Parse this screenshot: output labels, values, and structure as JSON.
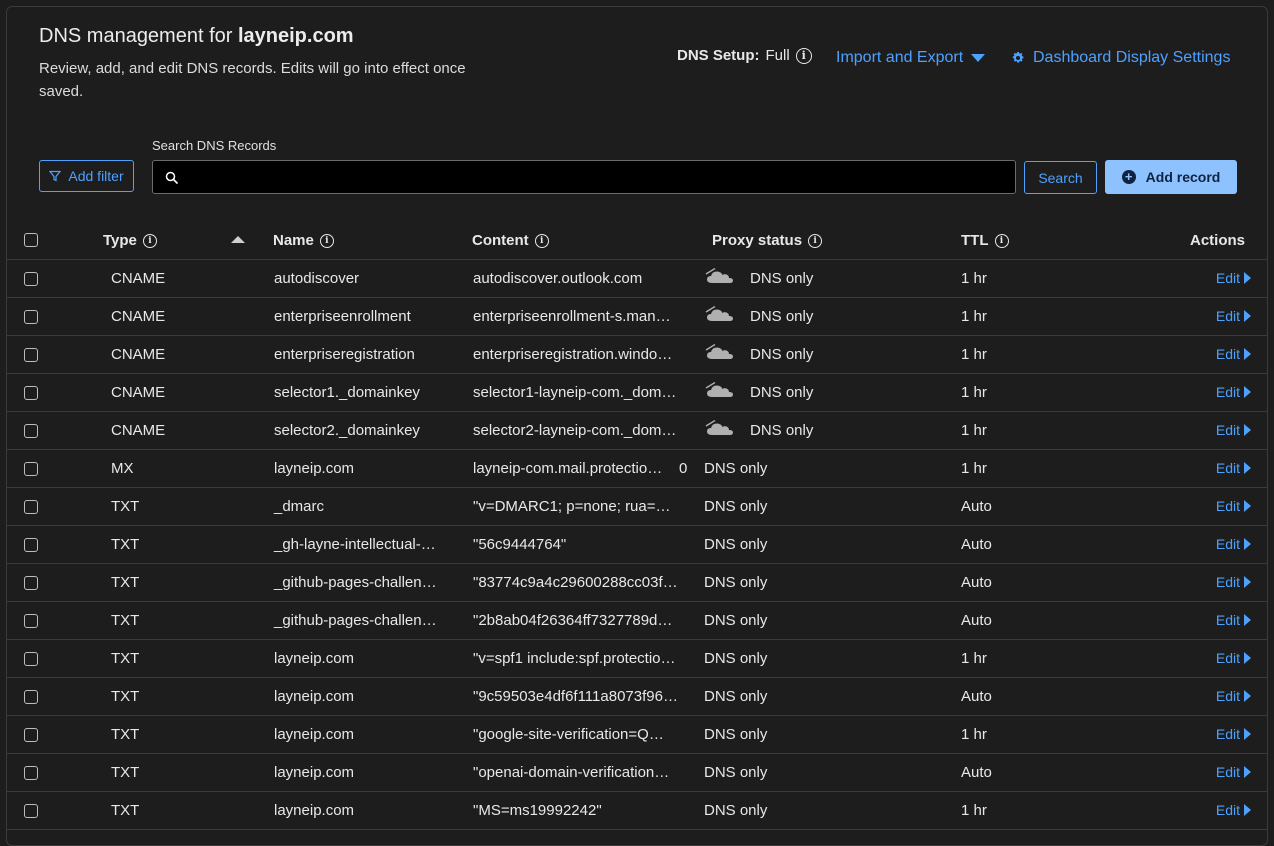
{
  "header": {
    "title_prefix": "DNS management for ",
    "domain": "layneip.com",
    "description": "Review, add, and edit DNS records. Edits will go into effect once saved.",
    "dns_setup_label": "DNS Setup:",
    "dns_setup_value": "Full",
    "import_export": "Import and Export",
    "dashboard_settings": "Dashboard Display Settings"
  },
  "toolbar": {
    "add_filter": "Add filter",
    "search_label": "Search DNS Records",
    "search_value": "",
    "search_button": "Search",
    "add_record": "Add record"
  },
  "columns": {
    "type": "Type",
    "name": "Name",
    "content": "Content",
    "proxy": "Proxy status",
    "ttl": "TTL",
    "actions": "Actions"
  },
  "edit_label": "Edit",
  "records": [
    {
      "type": "CNAME",
      "name": "autodiscover",
      "content": "autodiscover.outlook.com",
      "proxy": "DNS only",
      "cloud": true,
      "ttl": "1 hr"
    },
    {
      "type": "CNAME",
      "name": "enterpriseenrollment",
      "content": "enterpriseenrollment-s.man…",
      "proxy": "DNS only",
      "cloud": true,
      "ttl": "1 hr"
    },
    {
      "type": "CNAME",
      "name": "enterpriseregistration",
      "content": "enterpriseregistration.windo…",
      "proxy": "DNS only",
      "cloud": true,
      "ttl": "1 hr"
    },
    {
      "type": "CNAME",
      "name": "selector1._domainkey",
      "content": "selector1-layneip-com._dom…",
      "proxy": "DNS only",
      "cloud": true,
      "ttl": "1 hr"
    },
    {
      "type": "CNAME",
      "name": "selector2._domainkey",
      "content": "selector2-layneip-com._dom…",
      "proxy": "DNS only",
      "cloud": true,
      "ttl": "1 hr"
    },
    {
      "type": "MX",
      "name": "layneip.com",
      "content": "layneip-com.mail.protectio…",
      "priority": "0",
      "proxy": "DNS only",
      "cloud": false,
      "ttl": "1 hr"
    },
    {
      "type": "TXT",
      "name": "_dmarc",
      "content": "\"v=DMARC1; p=none; rua=…",
      "proxy": "DNS only",
      "cloud": false,
      "ttl": "Auto"
    },
    {
      "type": "TXT",
      "name": "_gh-layne-intellectual-…",
      "content": "\"56c9444764\"",
      "proxy": "DNS only",
      "cloud": false,
      "ttl": "Auto"
    },
    {
      "type": "TXT",
      "name": "_github-pages-challen…",
      "content": "\"83774c9a4c29600288cc03f…",
      "proxy": "DNS only",
      "cloud": false,
      "ttl": "Auto"
    },
    {
      "type": "TXT",
      "name": "_github-pages-challen…",
      "content": "\"2b8ab04f26364ff7327789d…",
      "proxy": "DNS only",
      "cloud": false,
      "ttl": "Auto"
    },
    {
      "type": "TXT",
      "name": "layneip.com",
      "content": "\"v=spf1 include:spf.protectio…",
      "proxy": "DNS only",
      "cloud": false,
      "ttl": "1 hr"
    },
    {
      "type": "TXT",
      "name": "layneip.com",
      "content": "\"9c59503e4df6f111a8073f96…",
      "proxy": "DNS only",
      "cloud": false,
      "ttl": "Auto"
    },
    {
      "type": "TXT",
      "name": "layneip.com",
      "content": "\"google-site-verification=Q…",
      "proxy": "DNS only",
      "cloud": false,
      "ttl": "1 hr"
    },
    {
      "type": "TXT",
      "name": "layneip.com",
      "content": "\"openai-domain-verification…",
      "proxy": "DNS only",
      "cloud": false,
      "ttl": "Auto"
    },
    {
      "type": "TXT",
      "name": "layneip.com",
      "content": "\"MS=ms19992242\"",
      "proxy": "DNS only",
      "cloud": false,
      "ttl": "1 hr"
    }
  ]
}
